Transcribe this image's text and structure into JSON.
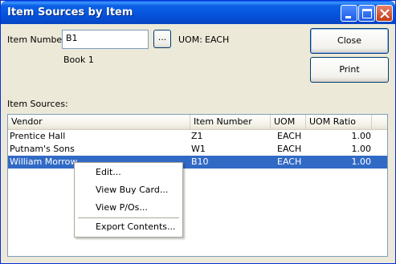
{
  "window": {
    "title": "Item Sources by Item"
  },
  "item": {
    "label": "Item Number:",
    "value": "B1",
    "browse_label": "...",
    "uom_label": "UOM:",
    "uom_value": "EACH",
    "description": "Book 1"
  },
  "buttons": {
    "close": "Close",
    "print": "Print"
  },
  "sources": {
    "label": "Item Sources:",
    "columns": [
      "Vendor",
      "Item Number",
      "UOM",
      "UOM Ratio"
    ],
    "rows": [
      {
        "vendor": "Prentice Hall",
        "item_number": "Z1",
        "uom": "EACH",
        "ratio": "1.00"
      },
      {
        "vendor": "Putnam's Sons",
        "item_number": "W1",
        "uom": "EACH",
        "ratio": "1.00"
      },
      {
        "vendor": "William Morrow",
        "item_number": "B10",
        "uom": "EACH",
        "ratio": "1.00"
      }
    ],
    "selected_row": 2
  },
  "context_menu": {
    "items": [
      "Edit...",
      "View Buy Card...",
      "View P/Os...",
      "Export Contents..."
    ]
  },
  "colors": {
    "titlebar": "#0553dc",
    "selection": "#316ac5",
    "face": "#ece9d8"
  }
}
